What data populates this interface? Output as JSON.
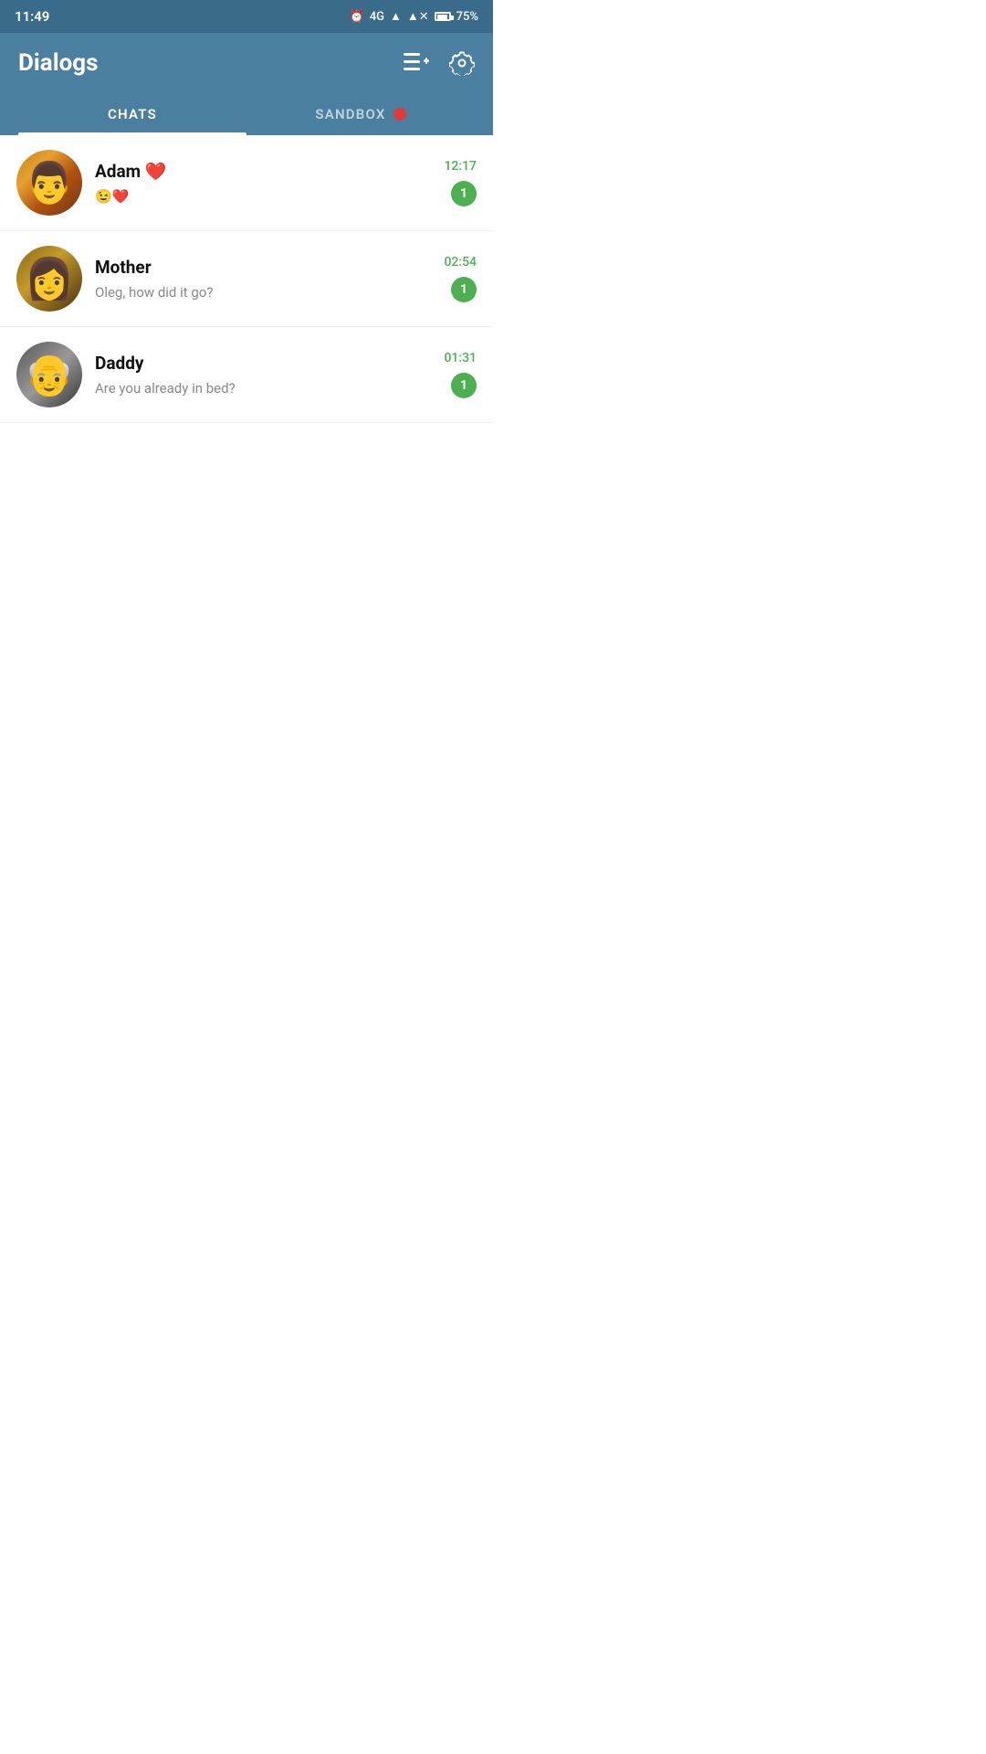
{
  "statusBar": {
    "time": "11:49",
    "network": "4G",
    "battery": "75%"
  },
  "header": {
    "title": "Dialogs",
    "addListIcon": "≡+",
    "settingsIcon": "⚙"
  },
  "tabs": [
    {
      "id": "chats",
      "label": "CHATS",
      "active": true
    },
    {
      "id": "sandbox",
      "label": "SANDBOX",
      "active": false,
      "hasDot": true
    }
  ],
  "chats": [
    {
      "id": "adam",
      "name": "Adam",
      "nameEmoji": "❤️",
      "preview": "😉❤️",
      "time": "12:17",
      "unread": "1",
      "avatarType": "adam"
    },
    {
      "id": "mother",
      "name": "Mother",
      "preview": "Oleg, how did it go?",
      "time": "02:54",
      "unread": "1",
      "avatarType": "mother"
    },
    {
      "id": "daddy",
      "name": "Daddy",
      "preview": "Are you already in bed?",
      "time": "01:31",
      "unread": "1",
      "avatarType": "daddy"
    }
  ],
  "colors": {
    "headerBg": "#4a7fa0",
    "activeTab": "#ffffff",
    "unreadBadge": "#4caf50",
    "sandboxDot": "#e53935",
    "chatTime": "#4caf50"
  }
}
